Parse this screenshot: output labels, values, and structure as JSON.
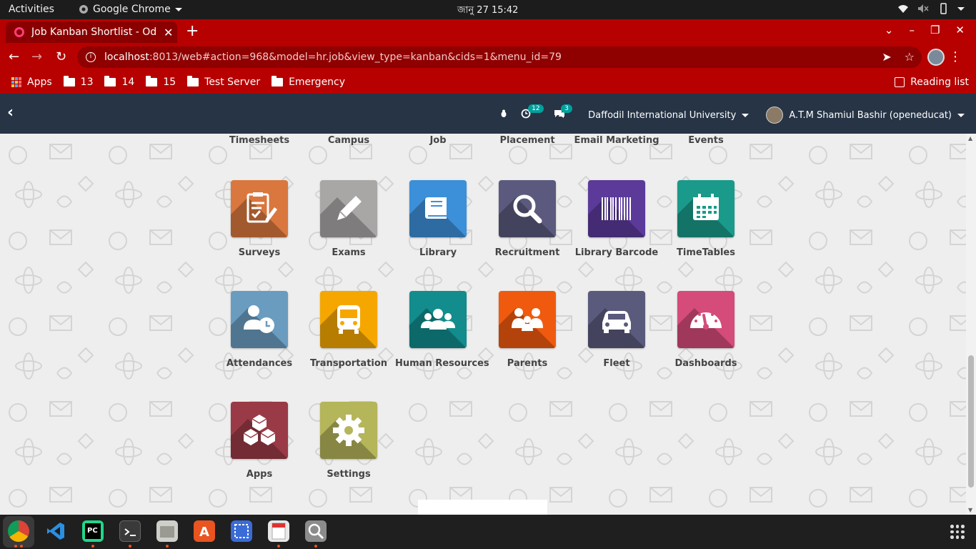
{
  "system_bar": {
    "activities": "Activities",
    "app_name": "Google Chrome",
    "clock": "জানু 27  15:42"
  },
  "browser": {
    "tab_title": "Job Kanban Shortlist - Od",
    "url_host": "localhost",
    "url_rest": ":8013/web#action=968&model=hr.job&view_type=kanban&cids=1&menu_id=79",
    "reading_list": "Reading list",
    "bookmarks": [
      {
        "label": "Apps",
        "icon": "apps-grid-icon"
      },
      {
        "label": "13",
        "icon": "folder-icon"
      },
      {
        "label": "14",
        "icon": "folder-icon"
      },
      {
        "label": "15",
        "icon": "folder-icon"
      },
      {
        "label": "Test Server",
        "icon": "folder-icon"
      },
      {
        "label": "Emergency",
        "icon": "folder-icon"
      }
    ],
    "accent": "#b70000"
  },
  "odoo_nav": {
    "activity_count": "12",
    "message_count": "3",
    "company": "Daffodil International University",
    "user": "A.T.M Shamiul Bashir (openeducat)"
  },
  "top_row_labels": [
    "Timesheets",
    "Campus",
    "Job",
    "Placement",
    "Email Marketing",
    "Events"
  ],
  "apps": [
    {
      "name": "Surveys",
      "icon": "clipboard-icon",
      "color": "#d9773e"
    },
    {
      "name": "Exams",
      "icon": "pencil-icon",
      "color": "#a9a6a6"
    },
    {
      "name": "Library",
      "icon": "book-icon",
      "color": "#3c8fd9"
    },
    {
      "name": "Recruitment",
      "icon": "magnifier-icon",
      "color": "#5b5a7e"
    },
    {
      "name": "Library Barcode",
      "icon": "barcode-icon",
      "color": "#5b3a9a"
    },
    {
      "name": "TimeTables",
      "icon": "calendar-icon",
      "color": "#1a9a8a"
    },
    {
      "name": "Attendances",
      "icon": "user-clock-icon",
      "color": "#6a9cc0"
    },
    {
      "name": "Transportation",
      "icon": "bus-icon",
      "color": "#f5a700"
    },
    {
      "name": "Human Resources",
      "icon": "users-icon",
      "color": "#128c8c"
    },
    {
      "name": "Parents",
      "icon": "family-icon",
      "color": "#f05a0f"
    },
    {
      "name": "Fleet",
      "icon": "car-icon",
      "color": "#5a5a7c"
    },
    {
      "name": "Dashboards",
      "icon": "gauge-icon",
      "color": "#d54b7a"
    },
    {
      "name": "Apps",
      "icon": "cubes-icon",
      "color": "#9a3a46"
    },
    {
      "name": "Settings",
      "icon": "gear-icon",
      "color": "#b5b55a"
    }
  ]
}
